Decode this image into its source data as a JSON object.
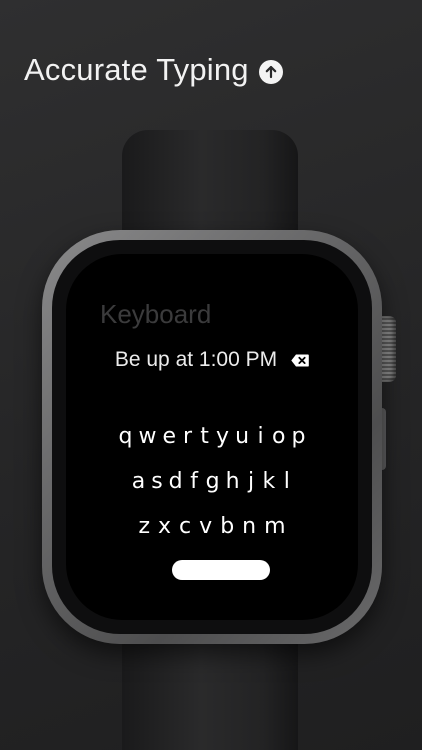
{
  "headline": {
    "text": "Accurate Typing",
    "icon": "arrow-up-circle-icon"
  },
  "watch": {
    "screen_title": "Keyboard",
    "input_text": "Be up at 1:00 PM",
    "delete_icon": "backspace-icon",
    "keyboard": {
      "row1": [
        "q",
        "w",
        "e",
        "r",
        "t",
        "y",
        "u",
        "i",
        "o",
        "p"
      ],
      "row2": [
        "a",
        "s",
        "d",
        "f",
        "g",
        "h",
        "j",
        "k",
        "l"
      ],
      "row3": [
        "z",
        "x",
        "c",
        "v",
        "b",
        "n",
        "m"
      ]
    },
    "space_icon": "space-bar"
  },
  "colors": {
    "background": "#2a2a2b",
    "screen": "#000000",
    "text": "#ffffff"
  }
}
